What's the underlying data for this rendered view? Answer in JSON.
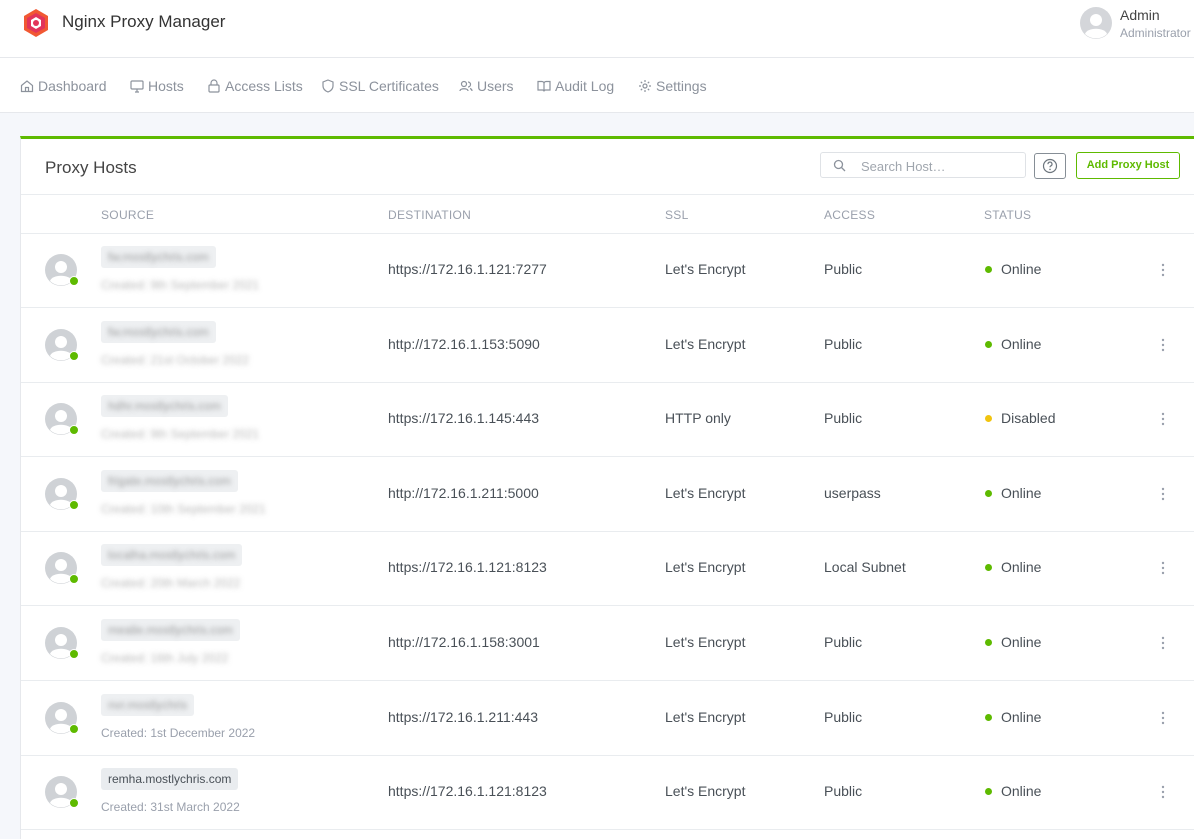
{
  "app": {
    "title": "Nginx Proxy Manager"
  },
  "user": {
    "name": "Admin",
    "role": "Administrator"
  },
  "nav": [
    {
      "label": "Dashboard",
      "icon": "home-icon"
    },
    {
      "label": "Hosts",
      "icon": "monitor-icon"
    },
    {
      "label": "Access Lists",
      "icon": "lock-icon"
    },
    {
      "label": "SSL Certificates",
      "icon": "shield-icon"
    },
    {
      "label": "Users",
      "icon": "users-icon"
    },
    {
      "label": "Audit Log",
      "icon": "book-icon"
    },
    {
      "label": "Settings",
      "icon": "gear-icon"
    }
  ],
  "card": {
    "title": "Proxy Hosts",
    "search_placeholder": "Search Host…",
    "add_button": "Add Proxy Host"
  },
  "columns": [
    "SOURCE",
    "DESTINATION",
    "SSL",
    "ACCESS",
    "STATUS"
  ],
  "rows": [
    {
      "source": "fw.mostlychris.com",
      "created": "Created: 9th September 2021",
      "blurred": true,
      "destination": "https://172.16.1.121:7277",
      "ssl": "Let's Encrypt",
      "access": "Public",
      "status": "Online",
      "status_color": "#5eba00"
    },
    {
      "source": "fw.mostlychris.com",
      "created": "Created: 21st October 2022",
      "blurred": true,
      "destination": "http://172.16.1.153:5090",
      "ssl": "Let's Encrypt",
      "access": "Public",
      "status": "Online",
      "status_color": "#5eba00"
    },
    {
      "source": "hdhr.mostlychris.com",
      "created": "Created: 9th September 2021",
      "blurred": true,
      "destination": "https://172.16.1.145:443",
      "ssl": "HTTP only",
      "access": "Public",
      "status": "Disabled",
      "status_color": "#f1c40f"
    },
    {
      "source": "frigate.mostlychris.com",
      "created": "Created: 10th September 2021",
      "blurred": true,
      "destination": "http://172.16.1.211:5000",
      "ssl": "Let's Encrypt",
      "access": "userpass",
      "status": "Online",
      "status_color": "#5eba00"
    },
    {
      "source": "localha.mostlychris.com",
      "created": "Created: 20th March 2022",
      "blurred": true,
      "destination": "https://172.16.1.121:8123",
      "ssl": "Let's Encrypt",
      "access": "Local Subnet",
      "status": "Online",
      "status_color": "#5eba00"
    },
    {
      "source": "mealie.mostlychris.com",
      "created": "Created: 16th July 2022",
      "blurred": true,
      "destination": "http://172.16.1.158:3001",
      "ssl": "Let's Encrypt",
      "access": "Public",
      "status": "Online",
      "status_color": "#5eba00"
    },
    {
      "source": "nvr.mostlychris",
      "created": "Created: 1st December 2022",
      "blurred": true,
      "created_clear": true,
      "destination": "https://172.16.1.211:443",
      "ssl": "Let's Encrypt",
      "access": "Public",
      "status": "Online",
      "status_color": "#5eba00"
    },
    {
      "source": "remha.mostlychris.com",
      "created": "Created: 31st March 2022",
      "blurred": false,
      "destination": "https://172.16.1.121:8123",
      "ssl": "Let's Encrypt",
      "access": "Public",
      "status": "Online",
      "status_color": "#5eba00"
    }
  ]
}
